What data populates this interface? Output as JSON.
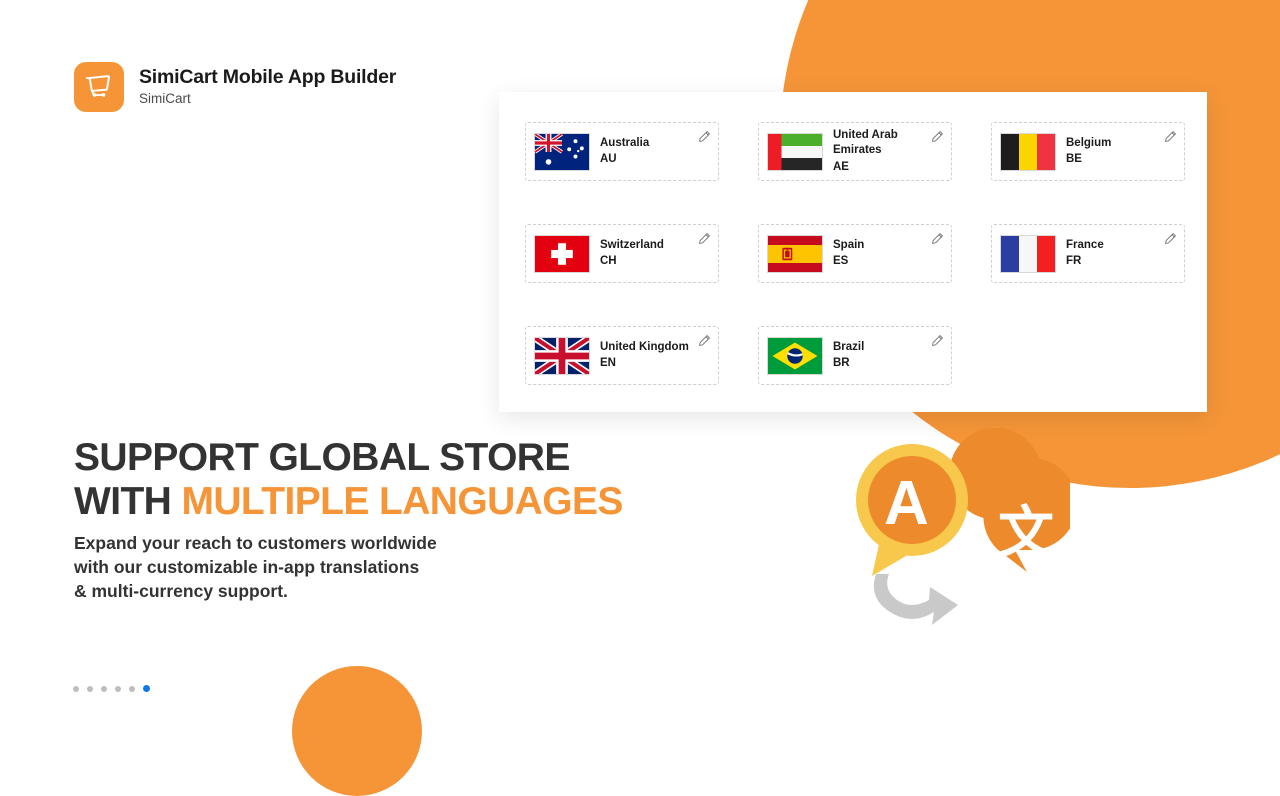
{
  "brand": {
    "title": "SimiCart Mobile App Builder",
    "subtitle": "SimiCart",
    "logo_icon": "shopping-cart-icon",
    "accent_color": "#F59538"
  },
  "panel": {
    "countries": [
      {
        "name": "Australia",
        "code": "AU",
        "flag": "flag-australia",
        "edit_icon": "pencil-icon"
      },
      {
        "name": "United Arab Emirates",
        "code": "AE",
        "flag": "flag-uae",
        "edit_icon": "pencil-icon"
      },
      {
        "name": "Belgium",
        "code": "BE",
        "flag": "flag-belgium",
        "edit_icon": "pencil-icon"
      },
      {
        "name": "Switzerland",
        "code": "CH",
        "flag": "flag-switzerland",
        "edit_icon": "pencil-icon"
      },
      {
        "name": "Spain",
        "code": "ES",
        "flag": "flag-spain",
        "edit_icon": "pencil-icon"
      },
      {
        "name": "France",
        "code": "FR",
        "flag": "flag-france",
        "edit_icon": "pencil-icon"
      },
      {
        "name": "United Kingdom",
        "code": "EN",
        "flag": "flag-united-kingdom",
        "edit_icon": "pencil-icon"
      },
      {
        "name": "Brazil",
        "code": "BR",
        "flag": "flag-brazil",
        "edit_icon": "pencil-icon"
      }
    ]
  },
  "hero": {
    "headline_line1": "SUPPORT GLOBAL STORE",
    "headline_line2_plain": "WITH ",
    "headline_line2_accent": "MULTIPLE LANGUAGES",
    "body_line1": "Expand your reach to customers worldwide",
    "body_line2": "with our customizable in-app translations",
    "body_line3": "& multi-currency support.",
    "headline_color": "#333333",
    "accent_color": "#F59538"
  },
  "illustration": {
    "name": "translation-bubbles-illustration",
    "latin_glyph": "A",
    "cjk_glyph": "文"
  },
  "pagination": {
    "total": 6,
    "active_index": 5,
    "active_color": "#0d78e8",
    "inactive_color": "#bdbdbd"
  }
}
